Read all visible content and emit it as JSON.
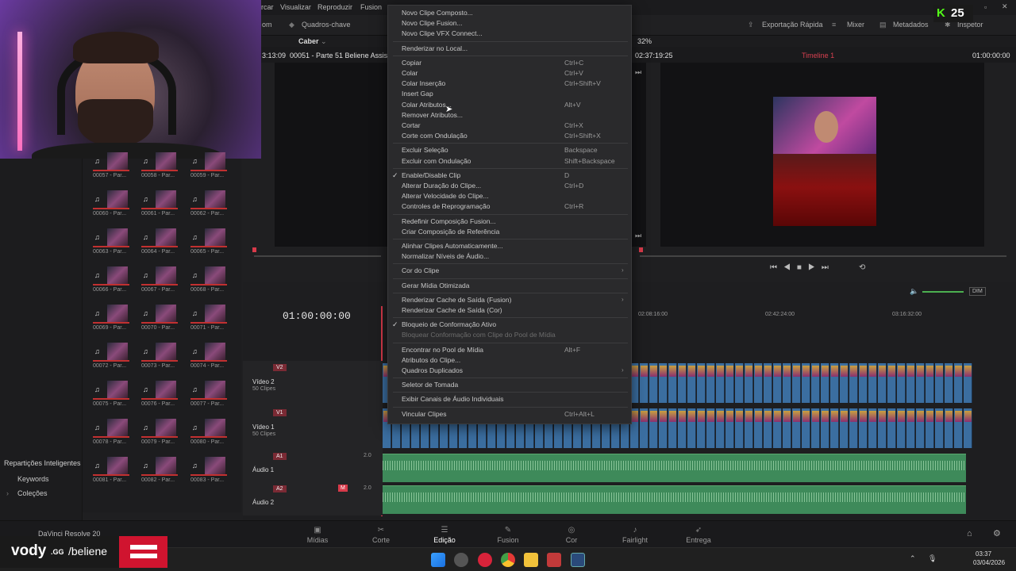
{
  "menubar": {
    "items": [
      "rcar",
      "Visualizar",
      "Reproduzir",
      "Fusion"
    ]
  },
  "toolbar": {
    "left_label": "om",
    "keyframes_label": "Quadros-chave",
    "fit_label": "Caber",
    "quick_export_label": "Exportação Rápida",
    "mixer_label": "Mixer",
    "metadata_label": "Metadados",
    "inspector_label": "Inspetor",
    "zoom_label": "32%"
  },
  "source_viewer": {
    "timecode": "3:13:09",
    "clip_name": "00051 - Parte 51 Beliene Assis"
  },
  "program_viewer": {
    "duration": "02:37:19:25",
    "timeline_name": "Timeline 1",
    "timecode": "01:00:00:00"
  },
  "timeline": {
    "current_timecode": "01:00:00:00",
    "ruler_marks": [
      "02:08:16:00",
      "02:42:24:00",
      "03:16:32:00"
    ],
    "tracks": [
      {
        "id": "V2",
        "name": "Vídeo 2",
        "count": "50 Clipes"
      },
      {
        "id": "V1",
        "name": "Vídeo 1",
        "count": "50 Clipes"
      },
      {
        "id": "A1",
        "name": "Áudio 1",
        "level": "2.0"
      },
      {
        "id": "A2",
        "name": "Áudio 2",
        "level": "2.0"
      }
    ],
    "dim_label": "DIM"
  },
  "sidebar": {
    "smart_bins_label": "Repartições Inteligentes",
    "keywords_label": "Keywords",
    "collections_label": "Coleções"
  },
  "media_pool": {
    "clips": [
      "00057 - Par...",
      "00058 - Par...",
      "00059 - Par...",
      "00060 - Par...",
      "00061 - Par...",
      "00062 - Par...",
      "00063 - Par...",
      "00064 - Par...",
      "00065 - Par...",
      "00066 - Par...",
      "00067 - Par...",
      "00068 - Par...",
      "00069 - Par...",
      "00070 - Par...",
      "00071 - Par...",
      "00072 - Par...",
      "00073 - Par...",
      "00074 - Par...",
      "00075 - Par...",
      "00076 - Par...",
      "00077 - Par...",
      "00078 - Par...",
      "00079 - Par...",
      "00080 - Par...",
      "00081 - Par...",
      "00082 - Par...",
      "00083 - Par..."
    ]
  },
  "context_menu": {
    "items": [
      {
        "label": "Novo Clipe Composto...",
        "shortcut": "",
        "disabled": false
      },
      {
        "label": "Novo Clipe Fusion...",
        "shortcut": "",
        "disabled": false
      },
      {
        "label": "Novo Clipe VFX Connect...",
        "shortcut": "",
        "disabled": false
      },
      {
        "label": "Renderizar no Local...",
        "shortcut": "",
        "disabled": false
      },
      {
        "label": "Copiar",
        "shortcut": "Ctrl+C",
        "disabled": false
      },
      {
        "label": "Colar",
        "shortcut": "Ctrl+V",
        "disabled": false
      },
      {
        "label": "Colar Inserção",
        "shortcut": "Ctrl+Shift+V",
        "disabled": false
      },
      {
        "label": "Insert Gap",
        "shortcut": "",
        "disabled": false
      },
      {
        "label": "Colar Atributos...",
        "shortcut": "Alt+V",
        "disabled": false
      },
      {
        "label": "Remover Atributos...",
        "shortcut": "",
        "disabled": false
      },
      {
        "label": "Cortar",
        "shortcut": "Ctrl+X",
        "disabled": false
      },
      {
        "label": "Corte com Ondulação",
        "shortcut": "Ctrl+Shift+X",
        "disabled": false
      },
      {
        "label": "Excluir Seleção",
        "shortcut": "Backspace",
        "disabled": false
      },
      {
        "label": "Excluir com Ondulação",
        "shortcut": "Shift+Backspace",
        "disabled": false
      },
      {
        "label": "Enable/Disable Clip",
        "shortcut": "D",
        "disabled": false
      },
      {
        "label": "Alterar Duração do Clipe...",
        "shortcut": "Ctrl+D",
        "disabled": false
      },
      {
        "label": "Alterar Velocidade do Clipe...",
        "shortcut": "",
        "disabled": false
      },
      {
        "label": "Controles de Reprogramação",
        "shortcut": "Ctrl+R",
        "disabled": false
      },
      {
        "label": "Redefinir Composição Fusion...",
        "shortcut": "",
        "disabled": false
      },
      {
        "label": "Criar Composição de Referência",
        "shortcut": "",
        "disabled": false
      },
      {
        "label": "Alinhar Clipes Automaticamente...",
        "shortcut": "",
        "disabled": false
      },
      {
        "label": "Normalizar Níveis de Áudio...",
        "shortcut": "",
        "disabled": false
      },
      {
        "label": "Cor do Clipe",
        "shortcut": "",
        "disabled": false
      },
      {
        "label": "Gerar Mídia Otimizada",
        "shortcut": "",
        "disabled": false
      },
      {
        "label": "Renderizar Cache de Saída (Fusion)",
        "shortcut": "",
        "disabled": false
      },
      {
        "label": "Renderizar Cache de Saída (Cor)",
        "shortcut": "",
        "disabled": false
      },
      {
        "label": "Bloqueio de Conformação Ativo",
        "shortcut": "",
        "disabled": false
      },
      {
        "label": "Bloquear Conformação com Clipe do Pool de Mídia",
        "shortcut": "",
        "disabled": true
      },
      {
        "label": "Encontrar no Pool de Mídia",
        "shortcut": "Alt+F",
        "disabled": false
      },
      {
        "label": "Atributos do Clipe...",
        "shortcut": "",
        "disabled": false
      },
      {
        "label": "Quadros Duplicados",
        "shortcut": "",
        "disabled": false
      },
      {
        "label": "Seletor de Tomada",
        "shortcut": "",
        "disabled": false
      },
      {
        "label": "Exibir Canais de Áudio Individuais",
        "shortcut": "",
        "disabled": false
      },
      {
        "label": "Vincular Clipes",
        "shortcut": "Ctrl+Alt+L",
        "disabled": false
      }
    ]
  },
  "pages": {
    "tabs": [
      "Mídias",
      "Corte",
      "Edição",
      "Fusion",
      "Cor",
      "Fairlight",
      "Entrega"
    ],
    "active": "Edição",
    "app_name": "DaVinci Resolve 20"
  },
  "taskbar": {
    "time": "03:37",
    "date": "03/04/2026"
  },
  "overlay": {
    "counter": "25",
    "brand": "vody",
    "brand_suffix": ".GG",
    "channel": "/beliene"
  }
}
